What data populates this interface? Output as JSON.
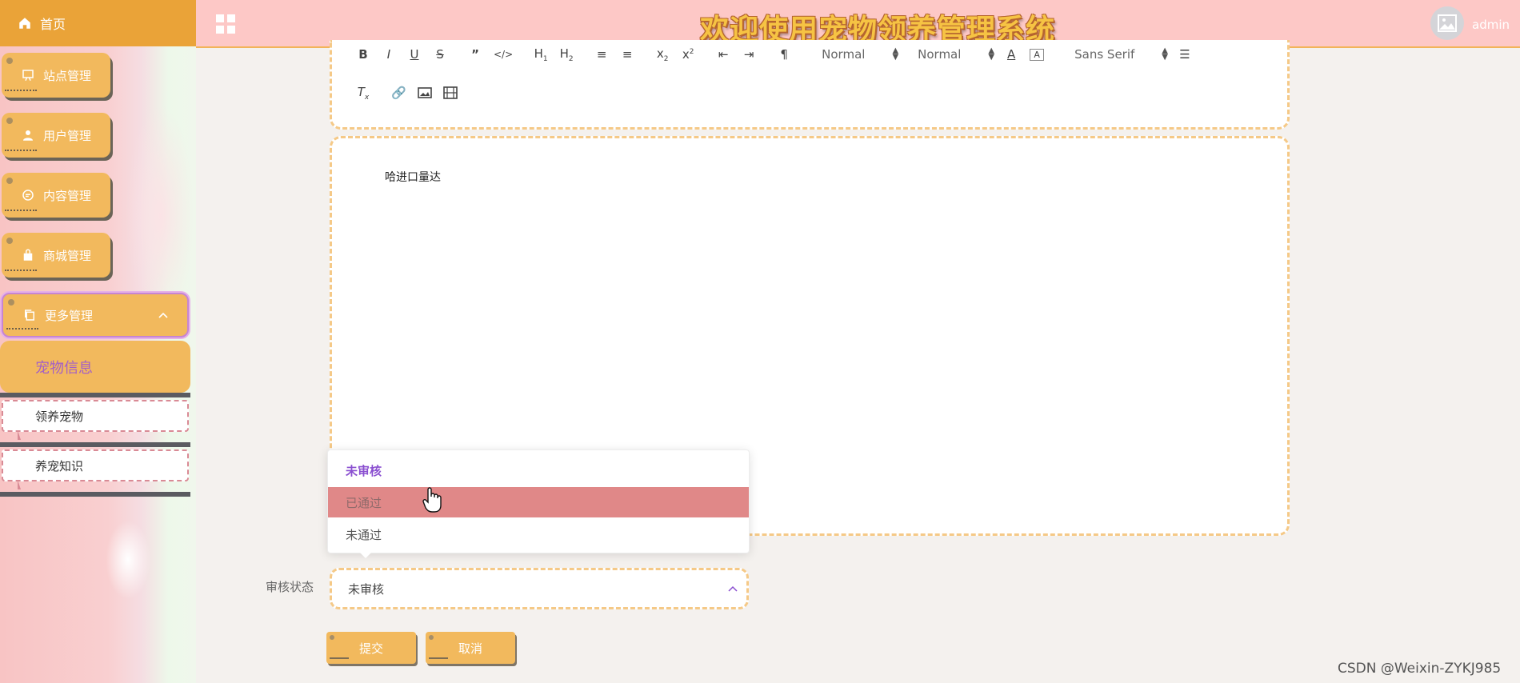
{
  "header": {
    "system_title": "欢迎使用宠物领养管理系统",
    "username": "admin"
  },
  "sidebar": {
    "home_label": "首页",
    "menu": [
      {
        "label": "站点管理",
        "icon": "monitor-icon"
      },
      {
        "label": "用户管理",
        "icon": "user-icon"
      },
      {
        "label": "内容管理",
        "icon": "message-icon"
      },
      {
        "label": "商城管理",
        "icon": "shopping-bag-icon"
      },
      {
        "label": "更多管理",
        "icon": "copy-icon",
        "expanded": true
      }
    ],
    "submenu_active": "宠物信息",
    "submenu": [
      "领养宠物",
      "养宠知识"
    ]
  },
  "editor": {
    "toolbar": {
      "header_select": "Normal",
      "size_select": "Normal",
      "font_select": "Sans Serif"
    },
    "content": "哈进口量达"
  },
  "form": {
    "status_label": "审核状态",
    "status_value": "未审核",
    "status_options": [
      "未审核",
      "已通过",
      "未通过"
    ],
    "hovered_option": "已通过",
    "submit_label": "提交",
    "cancel_label": "取消"
  },
  "watermark": "CSDN @Weixin-ZYKJ985",
  "colors": {
    "accent_orange": "#f2b95d",
    "header_pink": "#fdc8c6",
    "selected_option": "#8a4fd0",
    "hover_option": "#e08888"
  }
}
